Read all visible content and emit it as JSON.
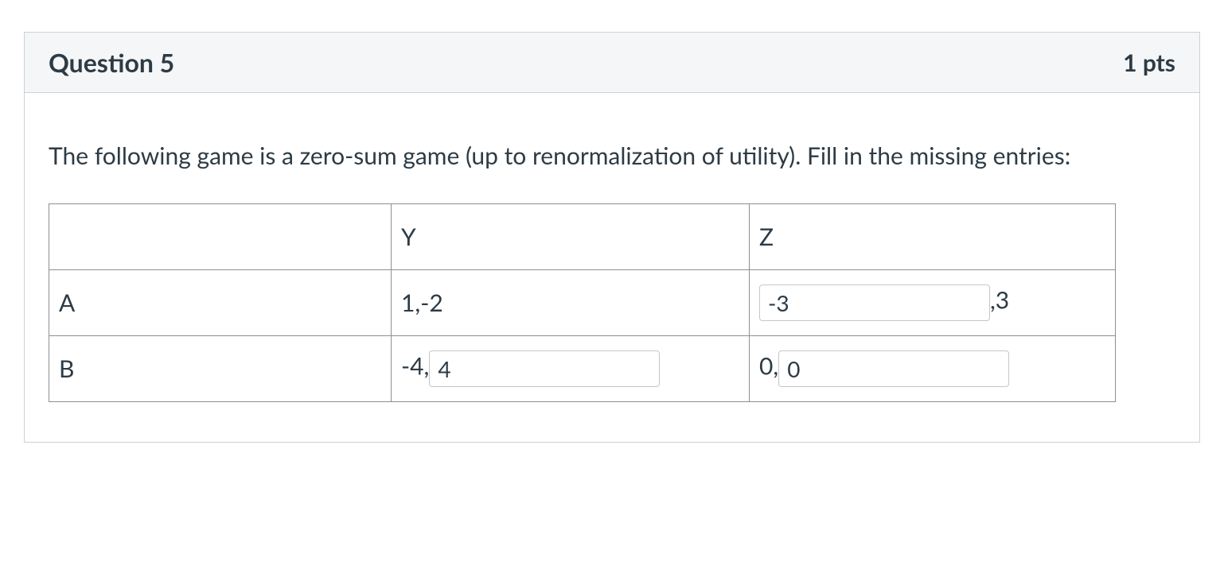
{
  "header": {
    "title": "Question 5",
    "points": "1 pts"
  },
  "prompt": "The following game is a zero-sum game (up to renormalization of utility). Fill in the missing entries:",
  "table": {
    "cols": [
      "Y",
      "Z"
    ],
    "rows": [
      "A",
      "B"
    ],
    "cells": {
      "A_Y": {
        "text": "1,-2"
      },
      "A_Z": {
        "input_value": "-3",
        "suffix": ",3"
      },
      "B_Y": {
        "prefix": "-4,",
        "input_value": "4"
      },
      "B_Z": {
        "prefix": "0,",
        "input_value": "0"
      }
    }
  }
}
